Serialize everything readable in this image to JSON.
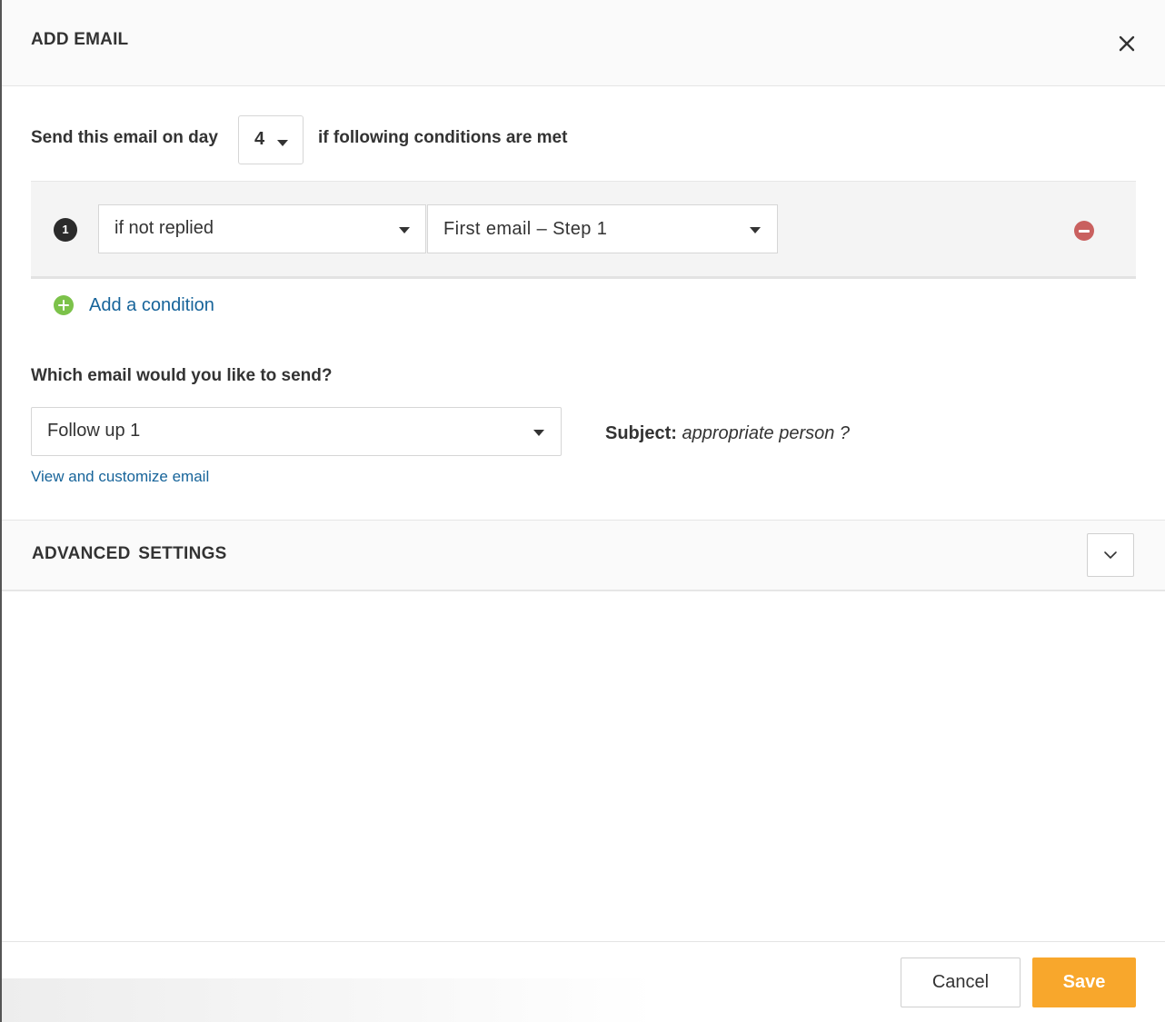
{
  "modal": {
    "title": "ADD EMAIL"
  },
  "schedule": {
    "prefix": "Send this email on day",
    "day_value": "4",
    "suffix": "if following conditions are met"
  },
  "conditions": [
    {
      "number": "1",
      "condition": "if not replied",
      "reference_email": "First email – Step 1"
    }
  ],
  "add_condition": {
    "label": "Add a condition"
  },
  "email_choice": {
    "question": "Which email would you like to send?",
    "selected": "Follow up 1",
    "subject_label": "Subject:",
    "subject_value": "appropriate person ?",
    "view_link": "View and customize email"
  },
  "advanced": {
    "label": "ADVANCED  SETTINGS"
  },
  "footer": {
    "cancel_label": "Cancel",
    "save_label": "Save"
  },
  "colors": {
    "link": "#17649a",
    "save_button": "#f8a72c",
    "add_icon": "#7cc24a",
    "remove_icon": "#c9605f"
  },
  "icons": {
    "close": "close-icon",
    "caret": "caret-down-icon",
    "add": "plus-circle-icon",
    "remove": "minus-circle-icon",
    "chevron": "chevron-down-icon"
  }
}
